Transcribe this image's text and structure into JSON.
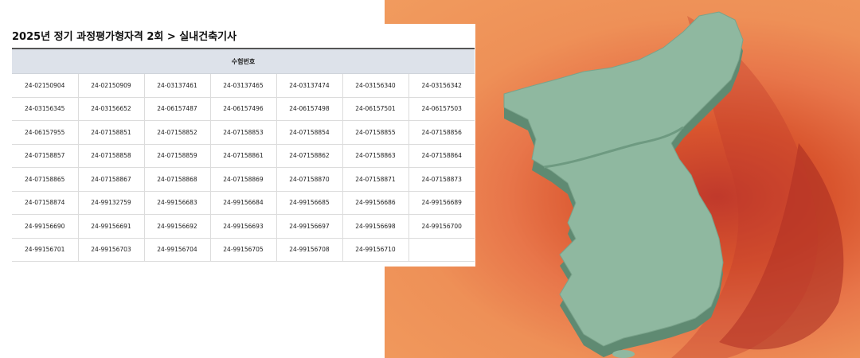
{
  "page": {
    "title": "2025년 정기 과정평가형자격 2회 > 실내건축기사"
  },
  "table": {
    "header": "수험번호",
    "rows": [
      [
        "24-02150904",
        "24-02150909",
        "24-03137461",
        "24-03137465",
        "24-03137474",
        "24-03156340",
        "24-03156342"
      ],
      [
        "24-03156345",
        "24-03156652",
        "24-06157487",
        "24-06157496",
        "24-06157498",
        "24-06157501",
        "24-06157503"
      ],
      [
        "24-06157955",
        "24-07158851",
        "24-07158852",
        "24-07158853",
        "24-07158854",
        "24-07158855",
        "24-07158856"
      ],
      [
        "24-07158857",
        "24-07158858",
        "24-07158859",
        "24-07158861",
        "24-07158862",
        "24-07158863",
        "24-07158864"
      ],
      [
        "24-07158865",
        "24-07158867",
        "24-07158868",
        "24-07158869",
        "24-07158870",
        "24-07158871",
        "24-07158873"
      ],
      [
        "24-07158874",
        "24-99132759",
        "24-99156683",
        "24-99156684",
        "24-99156685",
        "24-99156686",
        "24-99156689"
      ],
      [
        "24-99156690",
        "24-99156691",
        "24-99156692",
        "24-99156693",
        "24-99156697",
        "24-99156698",
        "24-99156700"
      ],
      [
        "24-99156701",
        "24-99156703",
        "24-99156704",
        "24-99156705",
        "24-99156708",
        "24-99156710",
        ""
      ]
    ]
  },
  "hero": {
    "icon": "korea-map-illustration",
    "colors": {
      "background": "#ee9057",
      "map": "#8fb8a0",
      "map_side": "#5f8a72",
      "shadow": "#b83224"
    }
  }
}
